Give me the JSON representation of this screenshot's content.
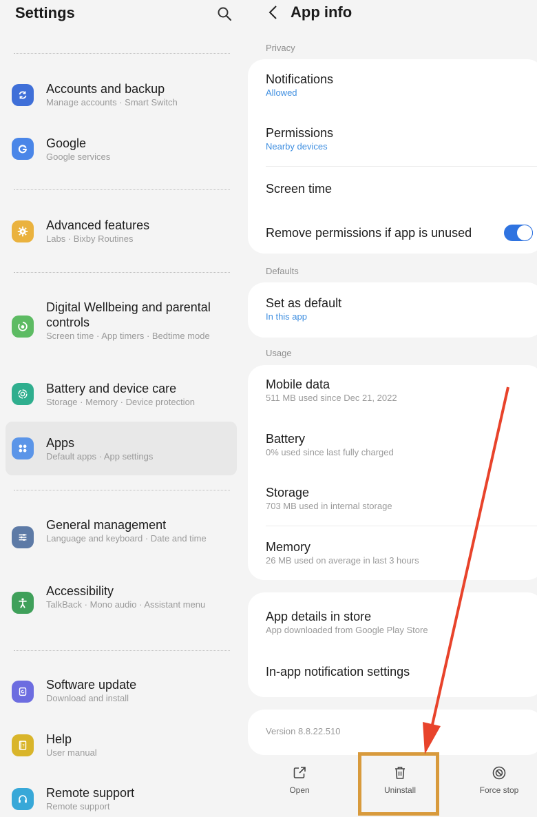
{
  "settings": {
    "title": "Settings",
    "search_icon": "search-icon",
    "items": [
      {
        "label": "Accounts and backup",
        "sub": "Manage accounts  ·  Smart Switch",
        "icon": "sync-icon",
        "color": "#3f6fd8"
      },
      {
        "label": "Google",
        "sub": "Google services",
        "icon": "google-icon",
        "color": "#4a86e8"
      },
      {
        "label": "Advanced features",
        "sub": "Labs  ·  Bixby Routines",
        "icon": "gear-plus-icon",
        "color": "#eab23e"
      },
      {
        "label": "Digital Wellbeing and parental controls",
        "sub": "Screen time  ·  App timers  ·  Bedtime mode",
        "icon": "wellbeing-icon",
        "color": "#5dbb63"
      },
      {
        "label": "Battery and device care",
        "sub": "Storage  ·  Memory  ·  Device protection",
        "icon": "device-care-icon",
        "color": "#2fae8e"
      },
      {
        "label": "Apps",
        "sub": "Default apps  ·  App settings",
        "icon": "apps-grid-icon",
        "color": "#5b95e8",
        "active": true
      },
      {
        "label": "General management",
        "sub": "Language and keyboard  ·  Date and time",
        "icon": "sliders-icon",
        "color": "#5d7aa6"
      },
      {
        "label": "Accessibility",
        "sub": "TalkBack  ·  Mono audio  ·  Assistant menu",
        "icon": "accessibility-icon",
        "color": "#3fa05a"
      },
      {
        "label": "Software update",
        "sub": "Download and install",
        "icon": "software-update-icon",
        "color": "#6d6de0"
      },
      {
        "label": "Help",
        "sub": "User manual",
        "icon": "help-book-icon",
        "color": "#d9b52a"
      },
      {
        "label": "Remote support",
        "sub": "Remote support",
        "icon": "headset-icon",
        "color": "#38a8d8"
      }
    ]
  },
  "app_info": {
    "title": "App info",
    "sections": {
      "privacy": "Privacy",
      "defaults": "Defaults",
      "usage": "Usage"
    },
    "privacy_items": [
      {
        "label": "Notifications",
        "sub": "Allowed"
      },
      {
        "label": "Permissions",
        "sub": "Nearby devices"
      },
      {
        "label": "Screen time"
      },
      {
        "label": "Remove permissions if app is unused",
        "toggle": true
      }
    ],
    "defaults_items": [
      {
        "label": "Set as default",
        "sub": "In this app"
      }
    ],
    "usage_items": [
      {
        "label": "Mobile data",
        "sub": "511 MB used since Dec 21, 2022"
      },
      {
        "label": "Battery",
        "sub": "0% used since last fully charged"
      },
      {
        "label": "Storage",
        "sub": "703 MB used in internal storage"
      },
      {
        "label": "Memory",
        "sub": "26 MB used on average in last 3 hours"
      }
    ],
    "store_items": [
      {
        "label": "App details in store",
        "sub": "App downloaded from Google Play Store"
      },
      {
        "label": "In-app notification settings"
      }
    ],
    "version": "Version 8.8.22.510",
    "actions": [
      {
        "label": "Open",
        "icon": "open-external-icon"
      },
      {
        "label": "Uninstall",
        "icon": "trash-icon"
      },
      {
        "label": "Force stop",
        "icon": "force-stop-icon"
      }
    ]
  },
  "annotation": {
    "arrow_color": "#e8432b",
    "box_color": "#d89a3c"
  }
}
